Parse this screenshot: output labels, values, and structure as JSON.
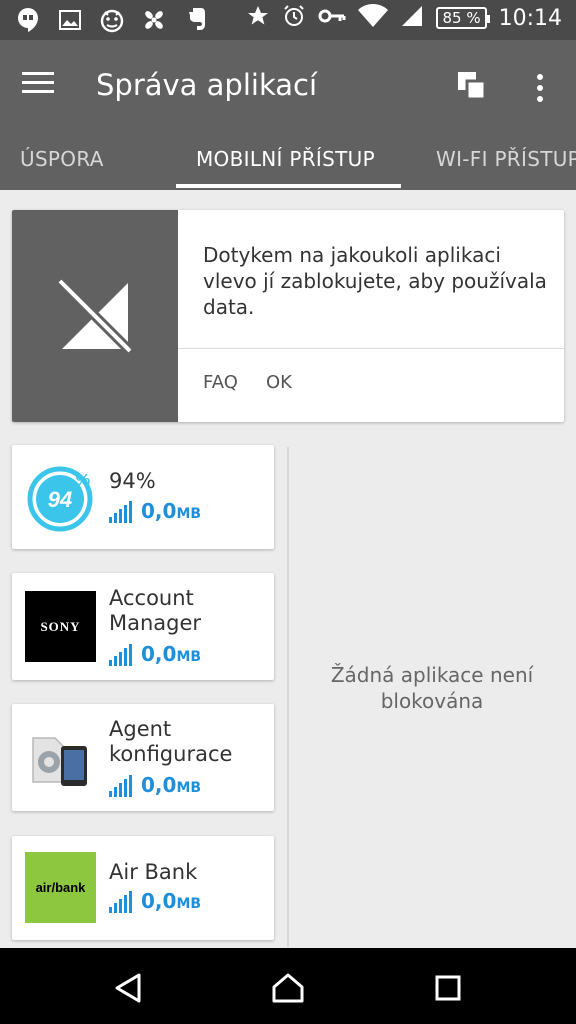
{
  "status_bar": {
    "battery": "85 %",
    "time": "10:14"
  },
  "app_bar": {
    "title": "Správa aplikací",
    "tabs": [
      {
        "label": "ÚSPORA"
      },
      {
        "label": "MOBILNÍ PŘÍSTUP"
      },
      {
        "label": "WI-FI PŘÍSTUP"
      }
    ],
    "active_tab": "MOBILNÍ PŘÍSTUP"
  },
  "info_card": {
    "text": "Dotykem na jakoukoli aplikaci vlevo jí zablokujete, aby používala data.",
    "faq_label": "FAQ",
    "ok_label": "OK"
  },
  "apps": [
    {
      "name": "94%",
      "usage": "0,0",
      "unit": "MB",
      "icon": "94-percent-icon"
    },
    {
      "name": "Account Manager",
      "usage": "0,0",
      "unit": "MB",
      "icon": "sony-icon",
      "logo_text": "SONY"
    },
    {
      "name": "Agent konfigurace",
      "usage": "0,0",
      "unit": "MB",
      "icon": "config-agent-icon"
    },
    {
      "name": "Air Bank",
      "usage": "0,0",
      "unit": "MB",
      "icon": "air-bank-icon",
      "logo_text": "air/bank"
    }
  ],
  "blocked_empty_text": "Žádná aplikace není blokována",
  "colors": {
    "status_bar": "#4a4a4a",
    "app_bar": "#616161",
    "accent_blue": "#1e8fdb",
    "background": "#ececec",
    "air_bank_green": "#8dc63f"
  }
}
